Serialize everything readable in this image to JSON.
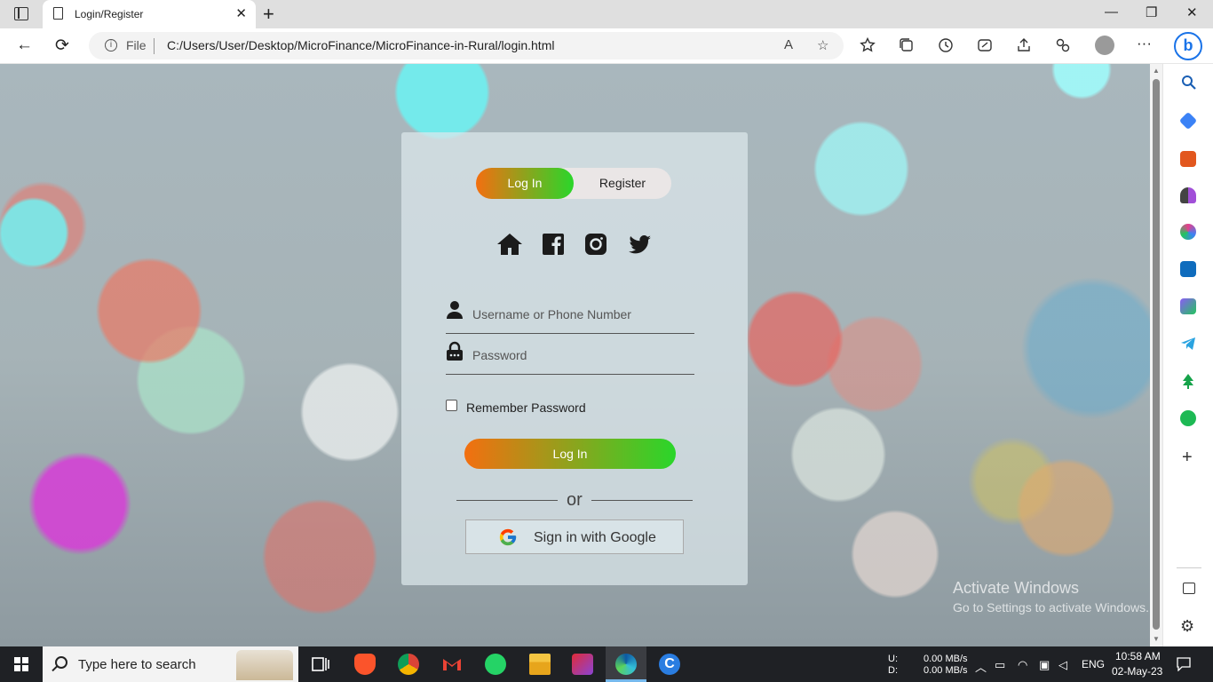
{
  "browser": {
    "tab_title": "Login/Register",
    "tab_close": "✕",
    "new_tab": "+",
    "window_controls": {
      "minimize": "—",
      "maximize": "❐",
      "close": "✕"
    },
    "back": "←",
    "reload": "⟳",
    "info_icon": "i",
    "protocol_label": "File",
    "url": "C:/Users/User/Desktop/MicroFinance/MicroFinance-in-Rural/login.html",
    "read_aloud_icon": "A",
    "favorite_icon": "☆",
    "menu_icon": "···",
    "bing_label": "b",
    "toolbar_icons": [
      "favorites-icon",
      "collections-icon",
      "history-icon",
      "performance-icon",
      "share-icon",
      "extensions-icon"
    ]
  },
  "card": {
    "toggle_login": "Log In",
    "toggle_register": "Register",
    "social_icons": [
      "home-icon",
      "facebook-icon",
      "instagram-icon",
      "twitter-icon"
    ],
    "username_placeholder": "Username or Phone Number",
    "password_placeholder": "Password",
    "remember_label": "Remember Password",
    "login_button": "Log In",
    "or_text": "or",
    "google_button": "Sign in with Google",
    "accent_gradient": [
      "#f36f10",
      "#2ad62a"
    ]
  },
  "watermark": {
    "title": "Activate Windows",
    "subtitle": "Go to Settings to activate Windows."
  },
  "sidebar": {
    "items": [
      "search-icon",
      "shopping-tag-icon",
      "tools-icon",
      "games-icon",
      "microsoft-365-icon",
      "outlook-icon",
      "designer-icon",
      "telegram-icon",
      "tree-icon",
      "spotify-icon"
    ],
    "add_label": "+",
    "settings_icon": "⚙"
  },
  "taskbar": {
    "search_placeholder": "Type here to search",
    "apps": [
      "task-view-icon",
      "brave-icon",
      "chrome-icon",
      "gmail-icon",
      "whatsapp-icon",
      "file-explorer-icon",
      "media-player-icon",
      "edge-icon",
      "ccleaner-icon"
    ],
    "net_up_label": "U:",
    "net_down_label": "D:",
    "net_up_value": "0.00 MB/s",
    "net_down_value": "0.00 MB/s",
    "language": "ENG",
    "time": "10:58 AM",
    "date": "02-May-23"
  }
}
